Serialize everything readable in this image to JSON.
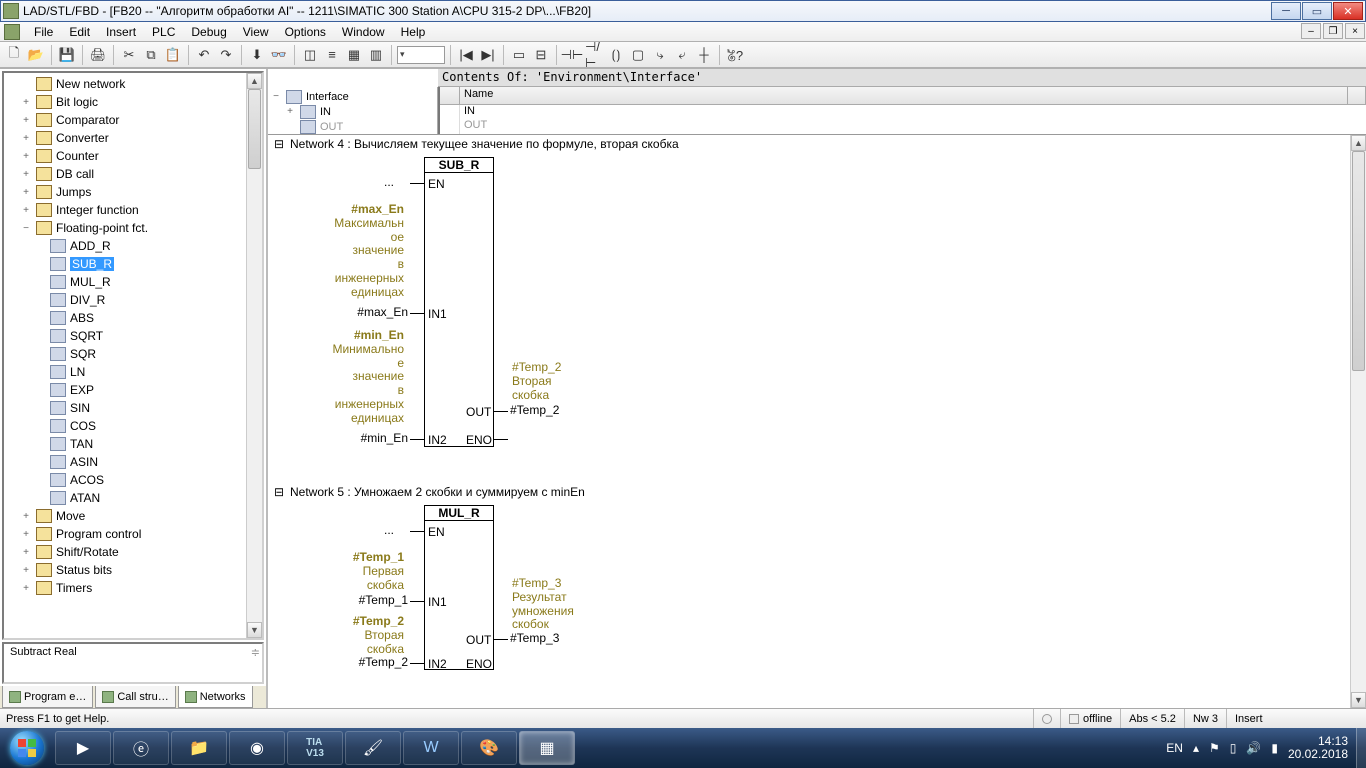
{
  "title": "LAD/STL/FBD  - [FB20 -- \"Алгоритм обработки AI\" -- 1211\\SIMATIC 300 Station A\\CPU 315-2 DP\\...\\FB20]",
  "menu": [
    "File",
    "Edit",
    "Insert",
    "PLC",
    "Debug",
    "View",
    "Options",
    "Window",
    "Help"
  ],
  "env_contents": "Contents Of: 'Environment\\Interface'",
  "iface_tree": {
    "root": "Interface",
    "child1": "IN",
    "child2": "OUT"
  },
  "grid": {
    "header": "Name",
    "row1": "IN",
    "row2": "OUT"
  },
  "tree": {
    "top": [
      {
        "lbl": "New network",
        "icon": "fld",
        "exp": ""
      },
      {
        "lbl": "Bit logic",
        "icon": "fld",
        "exp": "+"
      },
      {
        "lbl": "Comparator",
        "icon": "fld",
        "exp": "+"
      },
      {
        "lbl": "Converter",
        "icon": "fld",
        "exp": "+"
      },
      {
        "lbl": "Counter",
        "icon": "fld",
        "exp": "+"
      },
      {
        "lbl": "DB call",
        "icon": "fld",
        "exp": "+"
      },
      {
        "lbl": "Jumps",
        "icon": "fld",
        "exp": "+"
      },
      {
        "lbl": "Integer function",
        "icon": "fld",
        "exp": "+"
      },
      {
        "lbl": "Floating-point fct.",
        "icon": "fld",
        "exp": "−"
      }
    ],
    "fp": [
      "ADD_R",
      "SUB_R",
      "MUL_R",
      "DIV_R",
      "ABS",
      "SQRT",
      "SQR",
      "LN",
      "EXP",
      "SIN",
      "COS",
      "TAN",
      "ASIN",
      "ACOS",
      "ATAN"
    ],
    "fp_sel": "SUB_R",
    "bottom": [
      {
        "lbl": "Move",
        "exp": "+"
      },
      {
        "lbl": "Program control",
        "exp": "+"
      },
      {
        "lbl": "Shift/Rotate",
        "exp": "+"
      },
      {
        "lbl": "Status bits",
        "exp": "+"
      },
      {
        "lbl": "Timers",
        "exp": "+"
      }
    ]
  },
  "desc": "Subtract Real",
  "lefttabs": [
    "Program e…",
    "Call stru…",
    "Networks"
  ],
  "nw4": {
    "hdr": "Network 4 : Вычисляем текущее значение по формуле, вторая скобка",
    "box": "SUB_R",
    "en": "EN",
    "in1": "IN1",
    "in2": "IN2",
    "out": "OUT",
    "eno": "ENO",
    "dots": "...",
    "c1_h": "#max_En",
    "c1": "Максимальн\nое\nзначение\nв\nинженерных\nединицах",
    "v1": "#max_En",
    "c2_h": "#min_En",
    "c2": "Минимально\nе\nзначение\nв\nинженерных\nединицах",
    "v2": "#min_En",
    "co_h": "#Temp_2",
    "co": "Вторая\nскобка",
    "vo": "#Temp_2"
  },
  "nw5": {
    "hdr": "Network 5 : Умножаем 2 скобки и суммируем с minEn",
    "box": "MUL_R",
    "c1_h": "#Temp_1",
    "c1": "Первая\nскобка",
    "v1": "#Temp_1",
    "c2_h": "#Temp_2",
    "c2": "Вторая\nскобка",
    "v2": "#Temp_2",
    "co_h": "#Temp_3",
    "co": "Результат\nумножения\nскобок",
    "vo": "#Temp_3"
  },
  "status": {
    "help": "Press F1 to get Help.",
    "offline": "offline",
    "abs": "Abs < 5.2",
    "nw": "Nw 3",
    "ins": "Insert"
  },
  "tray": {
    "lang": "EN",
    "time": "14:13",
    "date": "20.02.2018"
  }
}
